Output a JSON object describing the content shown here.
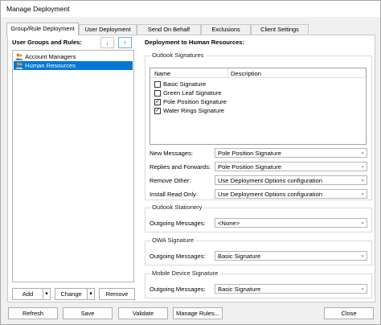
{
  "window": {
    "title": "Manage Deployment"
  },
  "tabs": [
    {
      "label": "Group/Rule Deployment"
    },
    {
      "label": "User Deployment"
    },
    {
      "label": "Send On Behalf"
    },
    {
      "label": "Exclusions"
    },
    {
      "label": "Client Settings"
    }
  ],
  "left": {
    "heading": "User Groups and Rules:",
    "move_down_glyph": "↓",
    "move_up_glyph": "↑",
    "items": [
      {
        "label": "Account Managers",
        "icon": "users-icon",
        "selected": false
      },
      {
        "label": "Human Resources",
        "icon": "users-icon",
        "selected": true
      }
    ],
    "add_label": "Add",
    "change_label": "Change",
    "remove_label": "Remove",
    "dropdown_glyph": "▾"
  },
  "right": {
    "heading": "Deployment to Human Resources:",
    "signatures": {
      "group_label": "Outlook Signatures",
      "columns": [
        "Name",
        "Description"
      ],
      "rows": [
        {
          "label": "Basic Signature",
          "checked": false
        },
        {
          "label": "Green Leaf Signature",
          "checked": false
        },
        {
          "label": "Pole Position Signature",
          "checked": true
        },
        {
          "label": "Water Rings Signature",
          "checked": true
        }
      ],
      "check_glyph": "✓",
      "fields": [
        {
          "label": "New Messages:",
          "value": "Pole Position Signature"
        },
        {
          "label": "Replies and Forwards:",
          "value": "Pole Position Signature"
        },
        {
          "label": "Remove Other:",
          "value": "Use Deployment Options configuration"
        },
        {
          "label": "Install Read Only:",
          "value": "Use Deployment Options configuration"
        }
      ]
    },
    "stationery": {
      "group_label": "Outlook Stationery",
      "field_label": "Outgoing Messages:",
      "value": "<None>"
    },
    "owa": {
      "group_label": "OWA Signature",
      "field_label": "Outgoing Messages:",
      "value": "Basic Signature"
    },
    "mobile": {
      "group_label": "Mobile Device Signature",
      "field_label": "Outgoing Messages:",
      "value": "Basic Signature"
    },
    "combo_arrow": "⌄"
  },
  "footer": {
    "refresh": "Refresh",
    "save": "Save",
    "validate": "Validate",
    "manage_rules": "Manage Rules...",
    "close": "Close"
  },
  "colors": {
    "selection": "#0078d7",
    "accent_arrow": "#1a73d1"
  }
}
